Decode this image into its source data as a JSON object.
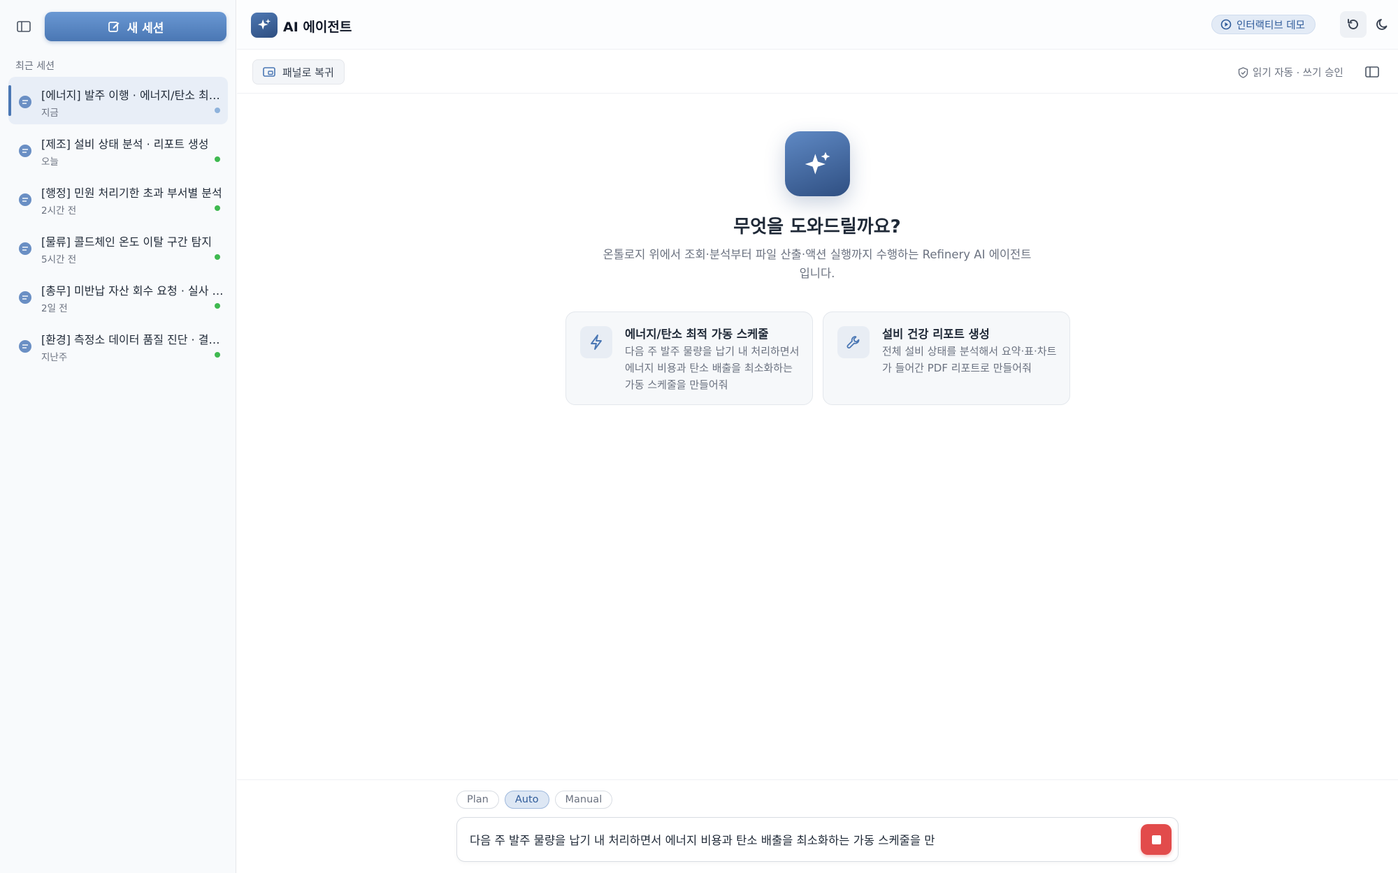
{
  "sidebar": {
    "new_session_label": "새 세션",
    "recent_title": "최근 세션",
    "sessions": [
      {
        "title": "[에너지] 발주 이행 · 에너지/탄소 최적 가동 스케줄",
        "time": "지금",
        "dot_color": "#8fb3dc",
        "active": true
      },
      {
        "title": "[제조] 설비 상태 분석 · 리포트 생성",
        "time": "오늘",
        "dot_color": "#3fb950",
        "active": false
      },
      {
        "title": "[행정] 민원 처리기한 초과 부서별 분석",
        "time": "2시간 전",
        "dot_color": "#3fb950",
        "active": false
      },
      {
        "title": "[물류] 콜드체인 온도 이탈 구간 탐지",
        "time": "5시간 전",
        "dot_color": "#3fb950",
        "active": false
      },
      {
        "title": "[총무] 미반납 자산 회수 요청 · 실사 결과",
        "time": "2일 전",
        "dot_color": "#3fb950",
        "active": false
      },
      {
        "title": "[환경] 측정소 데이터 품질 진단 · 결과 보고",
        "time": "지난주",
        "dot_color": "#3fb950",
        "active": false
      }
    ]
  },
  "header": {
    "title": "AI 에이전트",
    "demo_label": "인터랙티브 데모"
  },
  "subheader": {
    "restore_label": "패널로 복귀",
    "permission_label": "읽기 자동 · 쓰기 승인"
  },
  "hero": {
    "title": "무엇을 도와드릴까요?",
    "subtitle": "온톨로지 위에서 조회·분석부터 파일 산출·액션 실행까지 수행하는 Refinery AI 에이전트입니다."
  },
  "cards": [
    {
      "title": "에너지/탄소 최적 가동 스케줄",
      "desc": "다음 주 발주 물량을 납기 내 처리하면서 에너지 비용과 탄소 배출을 최소화하는 가동 스케줄을 만들어줘",
      "icon": "bolt-icon"
    },
    {
      "title": "설비 건강 리포트 생성",
      "desc": "전체 설비 상태를 분석해서 요약·표·차트가 들어간 PDF 리포트로 만들어줘",
      "icon": "wrench-icon"
    }
  ],
  "composer": {
    "modes": [
      "Plan",
      "Auto",
      "Manual"
    ],
    "active_mode": "Auto",
    "input_value": "다음 주 발주 물량을 납기 내 처리하면서 에너지 비용과 탄소 배출을 최소화하는 가동 스케줄을 만"
  },
  "colors": {
    "accent": "#4a77b4",
    "stop": "#e24b4b",
    "online": "#3fb950"
  }
}
